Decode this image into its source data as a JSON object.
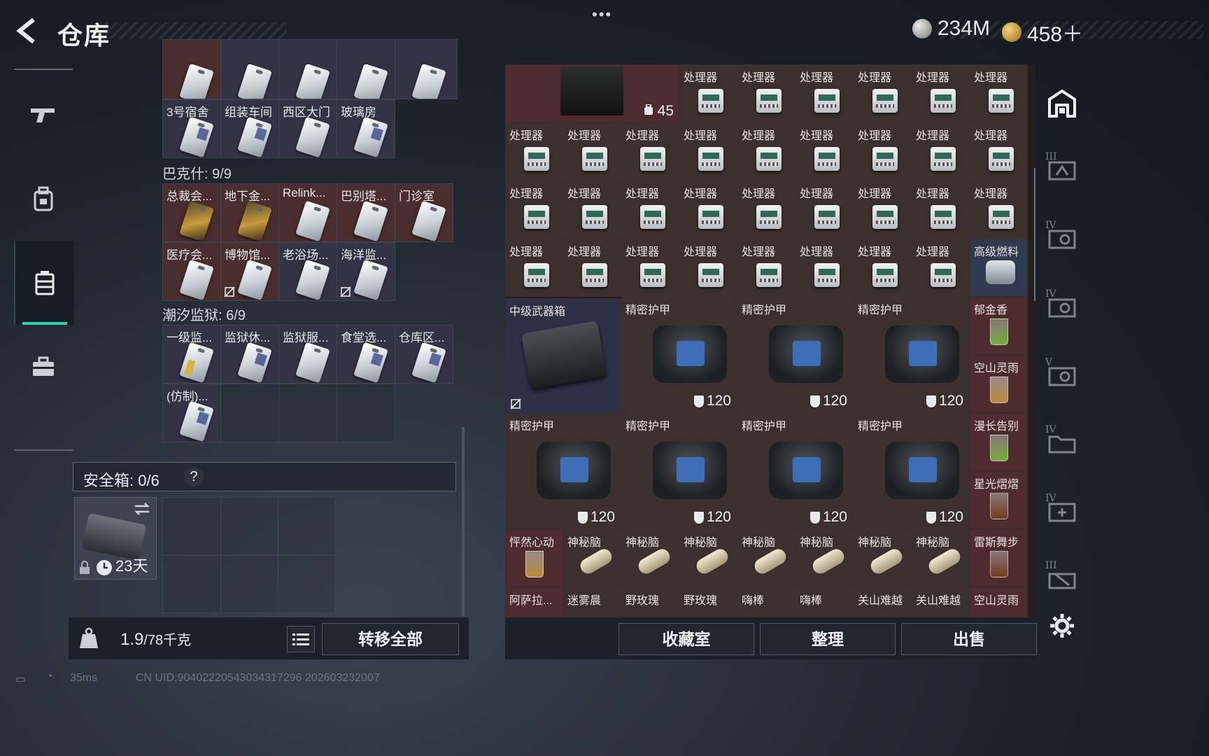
{
  "header": {
    "title": "仓库",
    "currency_1": "234M",
    "currency_2": "458＋"
  },
  "left_nav": [
    "gun-icon",
    "backpack-icon",
    "container-icon",
    "briefcase-icon"
  ],
  "left_panel": {
    "top_row_labels": [
      "",
      "",
      "",
      "",
      ""
    ],
    "row2_labels": [
      "3号宿舍",
      "组装车间",
      "西区大门",
      "玻璃房"
    ],
    "section_bakeshi": "巴克什: 9/9",
    "bakeshi_row1": [
      "总裁会...",
      "地下金...",
      "Relink...",
      "巴别塔...",
      "门诊室"
    ],
    "bakeshi_row2": [
      "医疗会...",
      "博物馆...",
      "老浴场...",
      "海洋监..."
    ],
    "section_chaoxi": "潮汐监狱: 6/9",
    "chaoxi_row1": [
      "一级监...",
      "监狱休...",
      "监狱服...",
      "食堂选...",
      "仓库区..."
    ],
    "chaoxi_row2": [
      "(仿制)..."
    ],
    "safebox_label": "安全箱: 0/6",
    "safebox_help": "?",
    "safebox_time": "23天",
    "weight_value": "1.9",
    "weight_max": "/78千克",
    "transfer_all": "转移全部"
  },
  "right_panel": {
    "bag_count": "45",
    "processor_label": "处理器",
    "fuel_label": "高级燃料",
    "weapon_box_label": "中级武器箱",
    "armor_label": "精密护甲",
    "armor_value": "120",
    "side_drinks": [
      "郁金香",
      "空山灵雨",
      "漫长告别",
      "星光熠熠"
    ],
    "row7_labels": [
      "怦然心动",
      "神秘脑",
      "神秘脑",
      "神秘脑",
      "神秘脑",
      "神秘脑",
      "神秘脑",
      "神秘脑",
      "雷斯舞步"
    ],
    "row8_labels": [
      "阿萨拉...",
      "迷雾晨",
      "野玫瑰",
      "野玫瑰",
      "嗨棒",
      "嗨棒",
      "关山难越",
      "关山难越",
      "空山灵雨"
    ],
    "btn_collection": "收藏室",
    "btn_sort": "整理",
    "btn_sell": "出售"
  },
  "right_nav": {
    "tiers": [
      "",
      "III",
      "IV",
      "IV",
      "V",
      "IV",
      "IV",
      "III"
    ]
  },
  "statusbar": {
    "ping": "35ms",
    "uid": "CN UID:9040222054303431729​6 202603232007"
  },
  "colors": {
    "accent": "#2fd0a8",
    "red_cell": "#4e2c2e",
    "purple_cell": "#2e3045"
  }
}
